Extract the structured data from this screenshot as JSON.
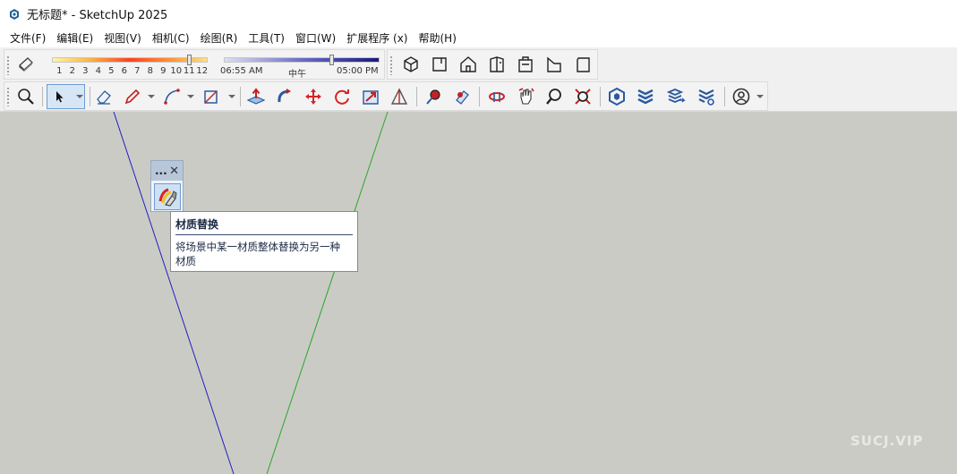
{
  "window": {
    "title": "无标题* - SketchUp 2025",
    "icon": "sketchup-logo-icon"
  },
  "menu": [
    "文件(F)",
    "编辑(E)",
    "视图(V)",
    "相机(C)",
    "绘图(R)",
    "工具(T)",
    "窗口(W)",
    "扩展程序 (x)",
    "帮助(H)"
  ],
  "shadows": {
    "months": [
      "1",
      "2",
      "3",
      "4",
      "5",
      "6",
      "7",
      "8",
      "9",
      "10",
      "11",
      "12"
    ],
    "month_value": 11,
    "time_start": "06:55 AM",
    "time_mid": "中午",
    "time_end": "05:00 PM",
    "time_fraction": 0.7
  },
  "views_toolbar": [
    "iso-view-icon",
    "top-view-icon",
    "front-view-icon",
    "right-view-icon",
    "back-view-icon",
    "left-view-icon",
    "bottom-view-icon"
  ],
  "main_toolbar": [
    "zoom-extents-icon",
    "select-icon",
    "eraser-icon",
    "pencil-icon",
    "arc-icon",
    "rectangle-icon",
    "push-pull-icon",
    "follow-me-icon",
    "move-icon",
    "rotate-icon",
    "scale-icon",
    "tape-measure-icon",
    "paint-bucket-icon",
    "material-icon",
    "orbit-icon",
    "pan-icon",
    "zoom-icon",
    "zoom-window-icon",
    "warehouse-icon",
    "extension-warehouse-icon",
    "layout-icon",
    "preferences-icon",
    "account-icon"
  ],
  "floating_toolbar": {
    "more": "...",
    "close": "✕",
    "tool_icon": "replace-material-icon"
  },
  "tooltip": {
    "title": "材质替换",
    "line1": "将场景中某一材质整体替换为另一种",
    "line2": "材质"
  },
  "watermark": "SUCJ.VIP",
  "colors": {
    "viewport_bg": "#cbcbc6",
    "blue_axis": "#2020c0",
    "green_axis": "#2aa52a",
    "accent": "#d32020"
  }
}
